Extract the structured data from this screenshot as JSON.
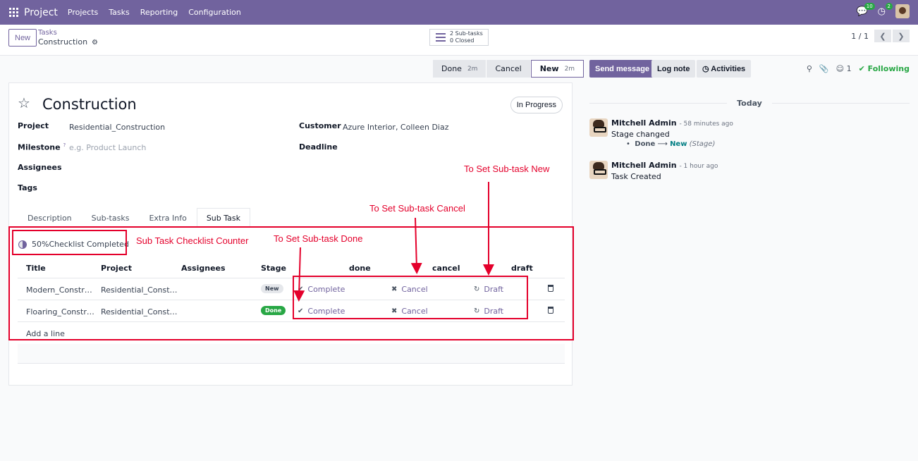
{
  "topbar": {
    "brand": "Project",
    "menu": [
      "Projects",
      "Tasks",
      "Reporting",
      "Configuration"
    ],
    "messages_count": "10",
    "activities_count": "2"
  },
  "control": {
    "new_label": "New",
    "breadcrumb_parent": "Tasks",
    "breadcrumb_current": "Construction",
    "smart_line1": "2 Sub-tasks",
    "smart_line2": "0 Closed",
    "pager": "1 / 1"
  },
  "statusbar": [
    {
      "label": "Done",
      "time": "2m"
    },
    {
      "label": "Cancel",
      "time": ""
    },
    {
      "label": "New",
      "time": "2m"
    }
  ],
  "form": {
    "title": "Construction",
    "status": "In Progress",
    "project_label": "Project",
    "project_value": "Residential_Construction",
    "milestone_label": "Milestone",
    "milestone_help": "?",
    "milestone_placeholder": "e.g. Product Launch",
    "assignees_label": "Assignees",
    "tags_label": "Tags",
    "customer_label": "Customer",
    "customer_value": "Azure Interior, Colleen Diaz",
    "deadline_label": "Deadline"
  },
  "tabs": [
    "Description",
    "Sub-tasks",
    "Extra Info",
    "Sub Task"
  ],
  "checklist": {
    "text": "50%Checklist Completed",
    "progress": 0.5
  },
  "subtasks": {
    "headers": [
      "Title",
      "Project",
      "Assignees",
      "Stage",
      "done",
      "cancel",
      "draft"
    ],
    "rows": [
      {
        "title": "Modern_Construc...",
        "project": "Residential_Constru...",
        "stage": "New",
        "complete": "Complete",
        "cancel": "Cancel",
        "draft": "Draft"
      },
      {
        "title": "Floaring_Construc...",
        "project": "Residential_Constru...",
        "stage": "Done",
        "complete": "Complete",
        "cancel": "Cancel",
        "draft": "Draft"
      }
    ],
    "add_line": "Add a line"
  },
  "chatter": {
    "send_message": "Send message",
    "log_note": "Log note",
    "activities": "Activities",
    "followers": "1",
    "following": "Following",
    "today": "Today",
    "messages": [
      {
        "author": "Mitchell Admin",
        "time": "- 58 minutes ago",
        "body": "Stage changed",
        "old": "Done",
        "new": "New",
        "field": "(Stage)"
      },
      {
        "author": "Mitchell Admin",
        "time": "- 1 hour ago",
        "body": "Task Created"
      }
    ]
  },
  "annotations": {
    "counter": "Sub Task Checklist Counter",
    "done": "To Set Sub-task Done",
    "cancel": "To Set Sub-task Cancel",
    "new": "To Set Sub-task New"
  },
  "colors": {
    "brand": "#71639e",
    "annotation": "#e4002b",
    "success": "#28a745"
  }
}
